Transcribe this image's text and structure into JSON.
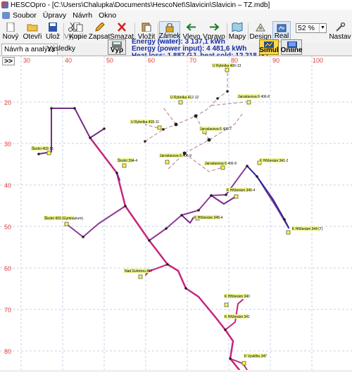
{
  "window": {
    "title": "HESCOpro - [C:\\Users\\Chalupka\\Documents\\HescoNet\\Slavicin\\Slavicin – TZ.mdb]"
  },
  "menu": [
    "Soubor",
    "Úpravy",
    "Návrh",
    "Okno"
  ],
  "toolbar": {
    "new": "Nový",
    "open": "Otevři",
    "save": "Ulož",
    "cut": "Vyjmi",
    "copy": "Kopie",
    "write": "Zapsat",
    "delete": "Smazat",
    "paste": "Vložit",
    "lock": "Zámek",
    "left": "Vlevo",
    "right": "Vpravo",
    "maps": "Mapy",
    "design": "Design",
    "real": "Real",
    "settings": "Nastav",
    "zoom": "52 %"
  },
  "tabs": {
    "design": "Návrh a analýza",
    "results": "Výsledky"
  },
  "buttons": {
    "calc": "Výp",
    "simul": "Simul",
    "online": "Online",
    "expand": ">>"
  },
  "energy": {
    "line1": "Energy (water):  3 137,1 kWh",
    "line2": "Energy (power input):  4 481,6 kWh",
    "line3": "Heat loss:  1 887 GJ, heat sold:  12 218 GJ"
  },
  "canvas": {
    "x_ticks": [
      "30",
      "40",
      "50",
      "60",
      "70",
      "80",
      "90",
      "100"
    ],
    "y_ticks": [
      "20",
      "30",
      "40",
      "50",
      "60",
      "70",
      "80"
    ],
    "labels": [
      "U Rybníka 406-13",
      "U Rybníka 412-12",
      "Jaroslavova 6 406-8",
      "U Rybníka 410-11",
      "Jaroslavova 6 406-7",
      "Jaroslavova 6 406-9",
      "Jaroslavova 6 406-9",
      "Školní 402-15",
      "Školní 394-4",
      "K Hřiženám 341-2",
      "K Hřiženám 340-4",
      "Školní 403 (Gymnázium)",
      "K Hřiženám 345-4",
      "K Hřiženám 344 (T)",
      "Nad Gvěrnou 487",
      "K Hřiženám 340",
      "K Hřiženám 341",
      "K Vyskřitu 347"
    ]
  },
  "colors": {
    "pipe_main": "#c8237e",
    "pipe_branch": "#7a2a8a",
    "pipe_blue": "#2a2aa0",
    "grid": "#b8c8e0",
    "tick": "#e03c3c",
    "node_fill": "#ffff33"
  }
}
